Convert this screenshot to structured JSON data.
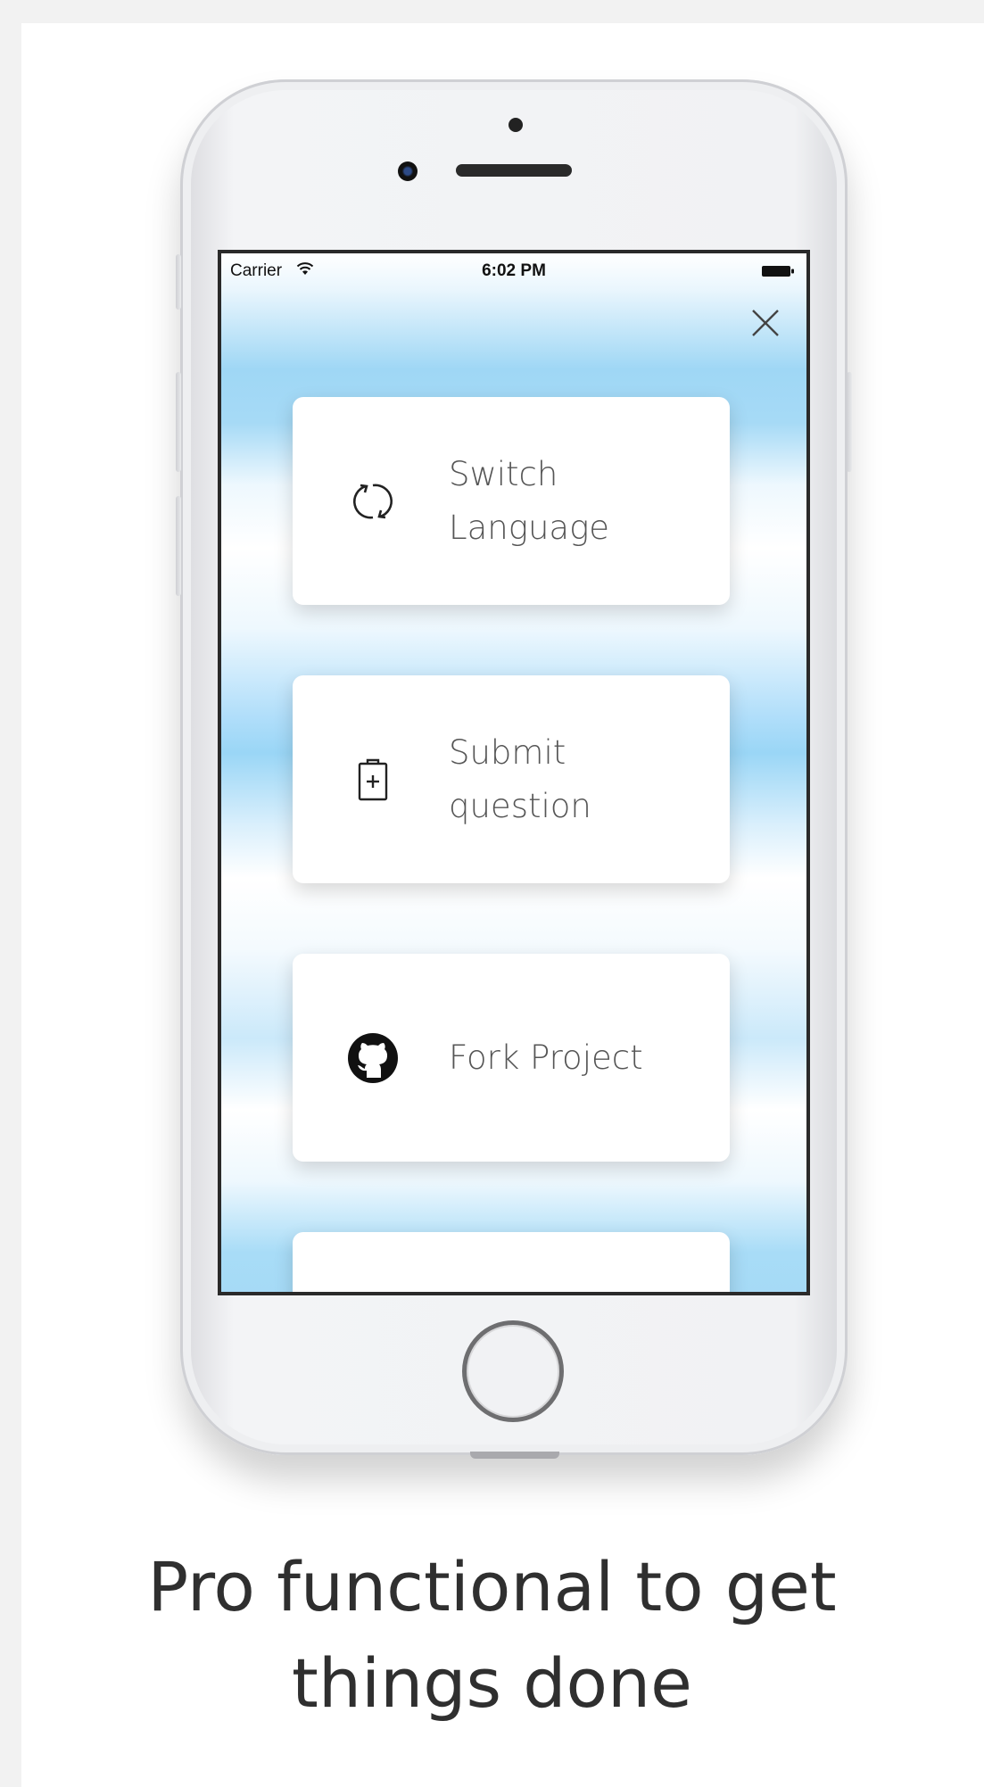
{
  "status_bar": {
    "carrier": "Carrier",
    "time": "6:02 PM",
    "wifi_icon": "wifi-icon",
    "battery_icon": "battery-icon"
  },
  "menu": {
    "close_icon": "close-icon",
    "items": [
      {
        "label": "Switch\nLanguage",
        "icon": "refresh-icon"
      },
      {
        "label": "Submit\nquestion",
        "icon": "clipboard-plus-icon"
      },
      {
        "label": "Fork Project",
        "icon": "github-icon"
      },
      {
        "label": "",
        "icon": ""
      }
    ]
  },
  "caption": "Pro functional to get\nthings done",
  "colors": {
    "screen_glow": "#9fd7f5",
    "card_background": "#ffffff",
    "label_text": "#555555",
    "caption_text": "#2f2f2f"
  }
}
